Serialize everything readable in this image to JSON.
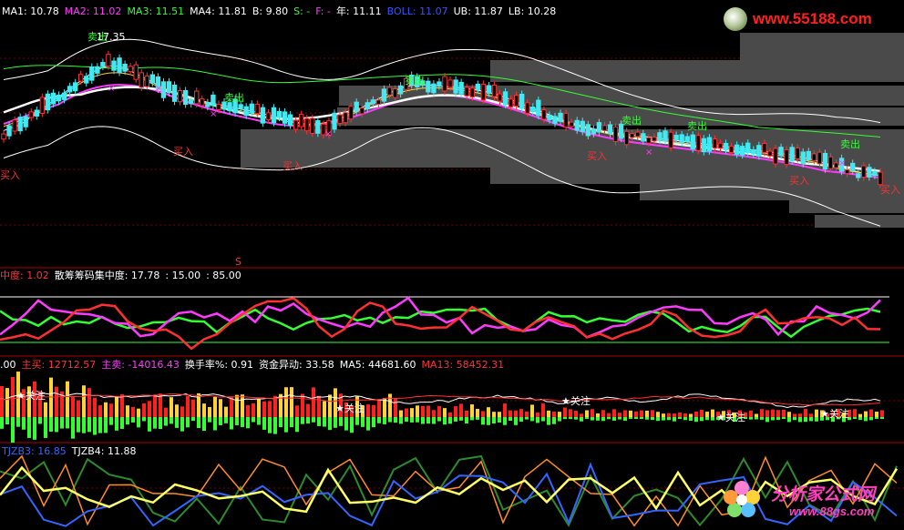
{
  "panel1": {
    "legend": [
      {
        "label": "MA1: 10.78",
        "color": "#ffffff"
      },
      {
        "label": "MA2: 11.02",
        "color": "#ff3bff"
      },
      {
        "label": "MA3: 11.51",
        "color": "#33ff33"
      },
      {
        "label": "MA4: 11.81",
        "color": "#ffffff"
      },
      {
        "label": "B: 9.80",
        "color": "#ffffff"
      },
      {
        "label": "S: -",
        "color": "#33ff33"
      },
      {
        "label": "F: -",
        "color": "#ff3bff"
      },
      {
        "label": "年: 11.11",
        "color": "#ffffff"
      },
      {
        "label": "BOLL: 11.07",
        "color": "#3355ff"
      },
      {
        "label": "UB: 11.87",
        "color": "#ffffff"
      },
      {
        "label": "LB: 10.28",
        "color": "#ffffff"
      }
    ],
    "high_label": "17.35",
    "annotations": {
      "sell": "卖出",
      "buy": "买入",
      "s_marker": "S"
    }
  },
  "panel2": {
    "legend": [
      {
        "label": "中度: 1.02",
        "color": "#ff3333"
      },
      {
        "label": "散筹筹码集中度: 17.78",
        "color": "#ffffff"
      },
      {
        "label": ": 15.00",
        "color": "#ffffff"
      },
      {
        "label": ": 85.00",
        "color": "#ffffff"
      }
    ]
  },
  "panel3": {
    "legend": [
      {
        "label": ".00",
        "color": "#ffffff"
      },
      {
        "label": "主买: 12712.57",
        "color": "#ff3333"
      },
      {
        "label": "主卖: -14016.43",
        "color": "#ff3bff"
      },
      {
        "label": "换手率%: 0.91",
        "color": "#ffffff"
      },
      {
        "label": "资金异动: 33.58",
        "color": "#ffffff"
      },
      {
        "label": "MA5: 44681.60",
        "color": "#ffffff"
      },
      {
        "label": "MA13: 58452.31",
        "color": "#ff3333"
      }
    ],
    "focus_label": "关注"
  },
  "panel4": {
    "legend": [
      {
        "label": "TJZB3: 16.85",
        "color": "#3366ff"
      },
      {
        "label": "TJZB4: 11.88",
        "color": "#ffffff"
      }
    ]
  },
  "watermarks": {
    "top": "www.55188.com",
    "bottom_cn": "分析家公式网",
    "bottom_url": "www.88gs.com"
  }
}
